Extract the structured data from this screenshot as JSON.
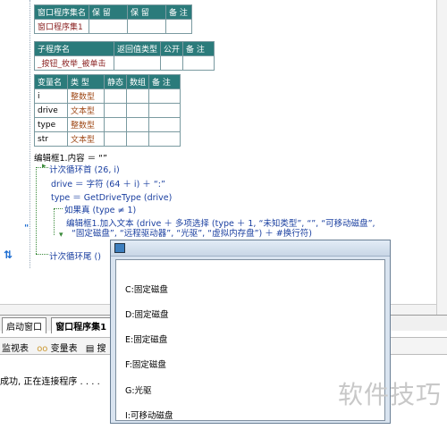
{
  "header_table": {
    "columns": [
      "窗口程序集名",
      "保 留",
      "保 留",
      "备 注"
    ],
    "row": [
      "窗口程序集1",
      "",
      "",
      ""
    ]
  },
  "sub_table": {
    "columns": [
      "子程序名",
      "返回值类型",
      "公开",
      "备 注"
    ],
    "row": [
      "_按钮_枚举_被单击",
      "",
      "",
      ""
    ]
  },
  "var_table": {
    "columns": [
      "变量名",
      "类 型",
      "静态",
      "数组",
      "备 注"
    ],
    "rows": [
      [
        "i",
        "整数型",
        "",
        "",
        ""
      ],
      [
        "drive",
        "文本型",
        "",
        "",
        ""
      ],
      [
        "type",
        "整数型",
        "",
        "",
        ""
      ],
      [
        "str",
        "文本型",
        "",
        "",
        ""
      ]
    ]
  },
  "code": {
    "line1": "编辑框1.内容 ＝ “”",
    "line2": "计次循环首 (26, i)",
    "line3": "drive ＝ 字符 (64 ＋ i) ＋ “:”",
    "line4": "type ＝ GetDriveType (drive)",
    "line5": "如果真 (type ≠ 1)",
    "line6": "编辑框1.加入文本 (drive ＋ 多项选择 (type ＋ 1, “未知类型”, “”, “可移动磁盘”,",
    "line7": "“固定磁盘”, “远程驱动器”, “光驱”, “虚拟内存盘”) ＋ #换行符)",
    "line8": "计次循环尾 ()"
  },
  "gutter_marks": {
    "quote": "\"",
    "arrows": "⇅"
  },
  "tabs": [
    "启动窗口",
    "窗口程序集1"
  ],
  "toolbar": {
    "watch": "监视表",
    "vars": "变量表",
    "search": "搜"
  },
  "status": "成功, 正在连接程序 . . . .",
  "dialog": {
    "lines": [
      "C:固定磁盘",
      "D:固定磁盘",
      "E:固定磁盘",
      "F:固定磁盘",
      "G:光驱",
      "I:可移动磁盘"
    ]
  },
  "watermark": "软件技巧"
}
